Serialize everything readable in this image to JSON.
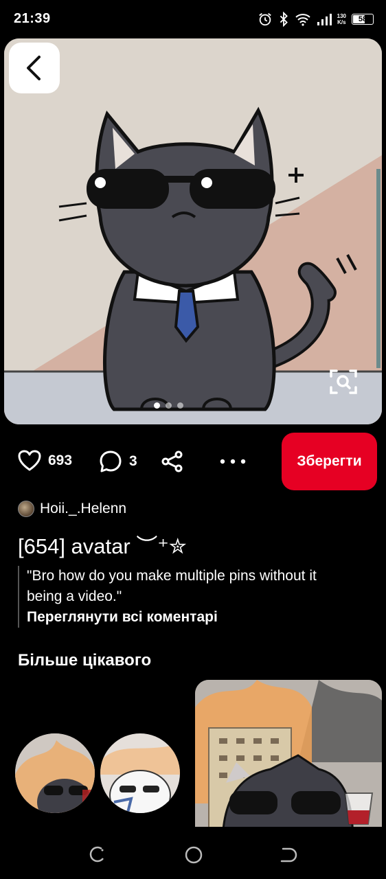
{
  "status_bar": {
    "time": "21:39",
    "net_speed_value": "130",
    "net_speed_unit": "K/s",
    "battery": "58",
    "icons": [
      "alarm-icon",
      "bluetooth-icon",
      "wifi-icon",
      "signal-icon",
      "battery-icon"
    ]
  },
  "pin": {
    "image_pages": 3,
    "active_page": 1
  },
  "actions": {
    "likes": "693",
    "comments": "3",
    "save_label": "Зберегти"
  },
  "author": {
    "name": "Hoii._.Helenn"
  },
  "title": "[654] avatar ︶⁺✮",
  "comment": {
    "text": "\"Bro how do you make multiple pins without it being a video.\"",
    "view_all": "Переглянути всі коментарі"
  },
  "more": {
    "heading": "Більше цікавого"
  },
  "colors": {
    "accent": "#e60023",
    "background": "#000000"
  }
}
